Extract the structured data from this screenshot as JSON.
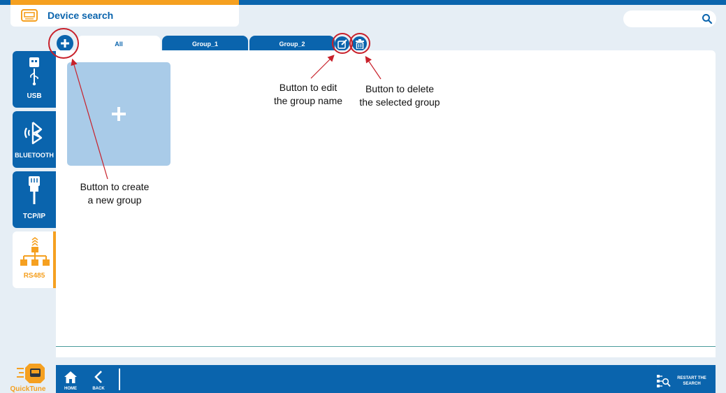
{
  "header": {
    "title": "Device search",
    "search_placeholder": ""
  },
  "tabs": [
    {
      "label": "All",
      "active": true
    },
    {
      "label": "Group_1",
      "active": false
    },
    {
      "label": "Group_2",
      "active": false
    }
  ],
  "sidebar": {
    "items": [
      {
        "label": "USB",
        "icon": "usb-icon",
        "active": false
      },
      {
        "label": "BLUETOOTH",
        "icon": "bluetooth-icon",
        "active": false
      },
      {
        "label": "TCP/IP",
        "icon": "ethernet-icon",
        "active": false
      },
      {
        "label": "RS485",
        "icon": "rs485-network-icon",
        "active": true
      }
    ]
  },
  "group_tile": {
    "icon": "plus-icon"
  },
  "annotations": {
    "create_line1": "Button to create",
    "create_line2": "a new group",
    "edit_line1": "Button to edit",
    "edit_line2": "the group name",
    "delete_line1": "Button to delete",
    "delete_line2": "the selected group"
  },
  "bottom_bar": {
    "home_label": "HOME",
    "back_label": "BACK",
    "restart_line1": "RESTART THE",
    "restart_line2": "SEARCH"
  },
  "logo": {
    "text": "QuickTune"
  },
  "colors": {
    "primary": "#0a64ad",
    "accent": "#f5a020",
    "tile": "#a9cbe8",
    "annotation_red": "#c8202a",
    "background": "#e6eef5"
  }
}
